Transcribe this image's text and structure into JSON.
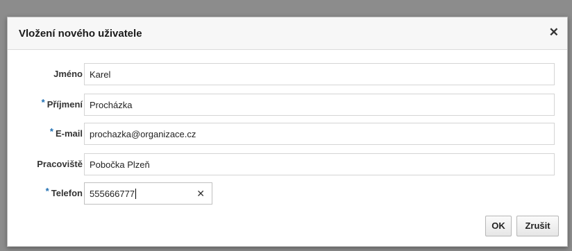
{
  "dialog": {
    "title": "Vložení nového uživatele",
    "close_icon": "close-icon"
  },
  "form": {
    "fields": [
      {
        "label": "Jméno",
        "required": false,
        "value": "Karel"
      },
      {
        "label": "Příjmení",
        "required": true,
        "value": "Procházka"
      },
      {
        "label": "E-mail",
        "required": true,
        "value": "prochazka@organizace.cz"
      },
      {
        "label": "Pracoviště",
        "required": false,
        "value": "Pobočka Plzeň"
      },
      {
        "label": "Telefon",
        "required": true,
        "value": "555666777"
      }
    ],
    "required_marker": "*",
    "required_color": "#1f6fb2"
  },
  "buttons": {
    "ok_label": "OK",
    "cancel_label": "Zrušit"
  }
}
